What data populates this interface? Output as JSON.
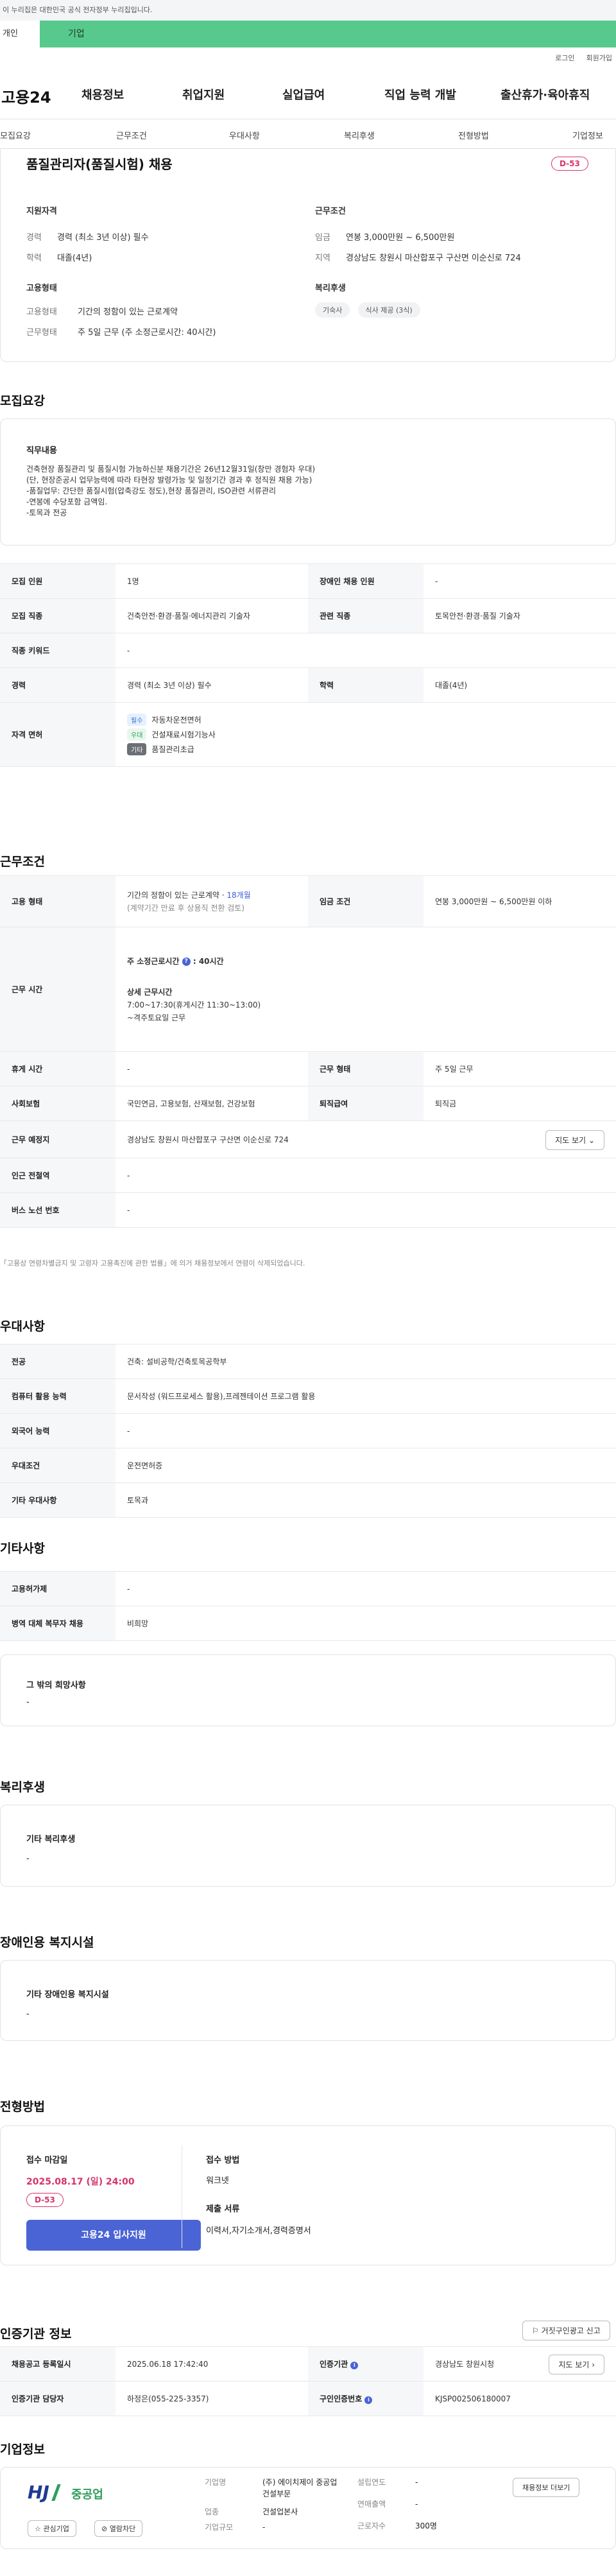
{
  "gov_notice": "이 누리집은 대한민국 공식 전자정부 누리집입니다.",
  "top_tabs": [
    "개인",
    "기업"
  ],
  "util_links": [
    "로그인",
    "회원가입"
  ],
  "logo": "고용24",
  "gnb": [
    "채용정보",
    "취업지원",
    "실업급여",
    "직업 능력 개발",
    "출산휴가·육아휴직"
  ],
  "snb": [
    "모집요강",
    "근무조건",
    "우대사항",
    "복리후생",
    "전형방법",
    "기업정보"
  ],
  "summary": {
    "title": "품질관리자(품질시험) 채용",
    "dday": "D-53",
    "qual_title": "지원자격",
    "qual": [
      {
        "k": "경력",
        "v": "경력 (최소 3년 이상) 필수"
      },
      {
        "k": "학력",
        "v": "대졸(4년)"
      }
    ],
    "cond_title": "근무조건",
    "cond": [
      {
        "k": "임금",
        "v": "연봉 3,000만원 ~ 6,500만원"
      },
      {
        "k": "지역",
        "v": "경상남도 창원시 마산합포구 구산면 이순신로 724"
      }
    ],
    "emp_title": "고용형태",
    "emp": [
      {
        "k": "고용형태",
        "v": "기간의 정함이 있는 근로계약"
      },
      {
        "k": "근무형태",
        "v": "주 5일 근무 (주 소정근로시간: 40시간)"
      }
    ],
    "welfare_title": "복리후생",
    "welfare_chips": [
      "기숙사",
      "식사 제공 (3식)"
    ]
  },
  "recruit": {
    "heading": "모집요강",
    "duty_title": "직무내용",
    "duty_lines": [
      "건축현장 품질관리 및 품질시험 가능하신분 채용기간은 26년12월31일(창만 경험자 우대)",
      "(단, 현장준공시 업무능력에 따라 타현장 발령가능 및 일정기간 경과 후 정직원 채용 가능)",
      "-품질업무: 간단한 품질시험(압축강도 정도),현장 품질관리, ISO관련 서류관리",
      "-연봉에 수당포함 금액임.",
      "-토목과 전공"
    ],
    "rows": [
      {
        "k": "모집 인원",
        "v": "1명",
        "k2": "장애인 채용 인원",
        "v2": "-"
      },
      {
        "k": "모집 직종",
        "v": "건축안전·환경·품질·에너지관리 기술자",
        "k2": "관련 직종",
        "v2": "토목안전·환경·품질 기술자"
      },
      {
        "k": "직종 키워드",
        "v": "-"
      },
      {
        "k": "경력",
        "v": "경력 (최소 3년 이상) 필수",
        "k2": "학력",
        "v2": "대졸(4년)"
      }
    ],
    "license_label": "자격 면허",
    "licenses": [
      {
        "tag": "필수",
        "name": "자동차운전면허",
        "color": "#e6f0ff",
        "fg": "#3b6fd6"
      },
      {
        "tag": "우대",
        "name": "건설재료시험기능사",
        "color": "#e8f7ee",
        "fg": "#2f9e5a"
      },
      {
        "tag": "기타",
        "name": "품질관리초급",
        "color": "#6b6f76",
        "fg": "#ffffff"
      }
    ]
  },
  "condition": {
    "heading": "근무조건",
    "emp_label": "고용 형태",
    "emp_value": "기간의 정함이 있는 근로계약 · ",
    "emp_months": "18개월",
    "emp_note": "(계약기간 만료 후 상용직 전환 검토)",
    "wage_label": "임금 조건",
    "wage_value": "연봉 3,000만원 ~ 6,500만원 이하",
    "hours_label": "근무 시간",
    "hours_week": "주 소정근로시간",
    "hours_week_value": ": 40시간",
    "hours_detail_title": "상세 근무시간",
    "hours_detail": "7:00~17:30(휴게시간 11:30~13:00)",
    "hours_extra": "~격주토요일 근무",
    "rows": [
      {
        "k": "휴게 시간",
        "v": "-",
        "k2": "근무 형태",
        "v2": "주 5일 근무"
      },
      {
        "k": "사회보험",
        "v": "국민연금, 고용보험, 산재보험, 건강보험",
        "k2": "퇴직급여",
        "v2": "퇴직금"
      }
    ],
    "place_label": "근무 예정지",
    "place_value": "경상남도 창원시 마산합포구 구산면 이순신로 724",
    "map_button": "지도 보기",
    "rows2": [
      {
        "k": "인근 전철역",
        "v": "-"
      },
      {
        "k": "버스 노선 번호",
        "v": "-"
      }
    ],
    "footnote": "「고용상 연령차별금지 및 고령자 고용촉진에 관한 법률」에 의거 채용정보에서 연령이 삭제되었습니다."
  },
  "preference": {
    "heading": "우대사항",
    "rows": [
      {
        "k": "전공",
        "v": "건축: 설비공학/건축토목공학부"
      },
      {
        "k": "컴퓨터 활용 능력",
        "v": "문서작성 (워드프로세스 활용),프레젠테이션 프로그램 활용"
      },
      {
        "k": "외국어 능력",
        "v": "-"
      },
      {
        "k": "우대조건",
        "v": "운전면허증"
      },
      {
        "k": "기타 우대사항",
        "v": "토목과"
      }
    ]
  },
  "etc": {
    "heading": "기타사항",
    "rows": [
      {
        "k": "고용허가제",
        "v": "-"
      },
      {
        "k": "병역 대체 복무자 채용",
        "v": "비희망"
      }
    ],
    "box_title": "그 밖의 희망사항",
    "box_value": "-"
  },
  "welfare": {
    "heading": "복리후생",
    "box_title": "기타 복리후생",
    "box_value": "-"
  },
  "facility": {
    "heading": "장애인용 복지시설",
    "box_title": "기타 장애인용 복지시설",
    "box_value": "-"
  },
  "process": {
    "heading": "전형방법",
    "deadline_title": "접수 마감일",
    "deadline_value": "2025.08.17 (일) 24:00",
    "dday": "D-53",
    "apply_button": "고용24 입사지원",
    "method_title": "접수 방법",
    "method_value": "워크넷",
    "docs_title": "제출 서류",
    "docs_value": "이력서,자기소개서,경력증명서"
  },
  "agency": {
    "heading": "인증기관 정보",
    "report_button": "거짓구인광고 신고",
    "rows": [
      {
        "k": "채용공고 등록일시",
        "v": "2025.06.18 17:42:40",
        "k2": "인증기관",
        "v2": "경상남도 창원시청"
      },
      {
        "k": "인증기관 담당자",
        "v": "하정은(055-225-3357)",
        "k2": "구인인증번호",
        "v2": "KJSP002506180007"
      }
    ],
    "map_button": "지도 보기"
  },
  "company": {
    "heading": "기업정보",
    "logo_text": "HJ",
    "logo_sub": "중공업",
    "interest_button": "관심기업",
    "block_button": "열람차단",
    "fields_left": [
      {
        "k": "기업명",
        "v": "(주) 에이치제이 중공업 건설부문"
      },
      {
        "k": "업종",
        "v": "건설업본사"
      },
      {
        "k": "기업규모",
        "v": "-"
      }
    ],
    "fields_right": [
      {
        "k": "설립연도",
        "v": "-"
      },
      {
        "k": "연매출액",
        "v": "-"
      },
      {
        "k": "근로자수",
        "v": "300명"
      }
    ],
    "jobs_button": "채용정보 더보기"
  }
}
